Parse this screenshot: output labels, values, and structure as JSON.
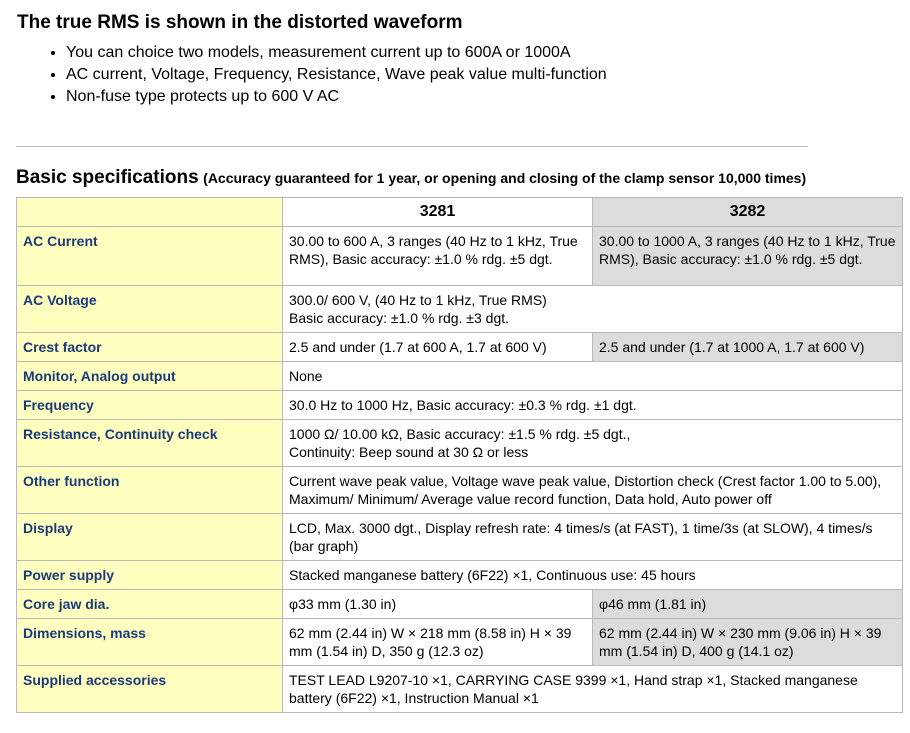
{
  "header": {
    "title": "The true RMS is shown in the distorted waveform",
    "bullets": [
      "You can choice two models, measurement current up to 600A or 1000A",
      "AC current, Voltage, Frequency, Resistance, Wave peak value multi-function",
      "Non-fuse type protects up to 600 V AC"
    ]
  },
  "specs": {
    "title": "Basic specifications",
    "note": "(Accuracy guaranteed for 1 year, or opening and closing of the clamp sensor 10,000 times)",
    "models": [
      "3281",
      "3282"
    ],
    "rows": [
      {
        "label": "AC Current",
        "a": "30.00 to 600 A, 3 ranges (40 Hz to 1 kHz, True RMS), Basic accuracy: ±1.0 % rdg. ±5 dgt.",
        "b": "30.00 to 1000 A, 3 ranges (40 Hz to 1 kHz, True RMS), Basic accuracy: ±1.0 % rdg. ±5 dgt."
      },
      {
        "label": "AC Voltage",
        "shared": "300.0/ 600 V, (40 Hz to 1 kHz, True RMS)\nBasic accuracy: ±1.0 % rdg. ±3 dgt."
      },
      {
        "label": "Crest factor",
        "a": "2.5 and under (1.7 at 600 A, 1.7 at 600 V)",
        "b": "2.5 and under (1.7 at 1000 A, 1.7 at 600 V)"
      },
      {
        "label": "Monitor, Analog output",
        "shared": "None"
      },
      {
        "label": "Frequency",
        "shared": "30.0 Hz to 1000 Hz, Basic accuracy: ±0.3 % rdg. ±1 dgt."
      },
      {
        "label": "Resistance, Continuity check",
        "shared": "1000 Ω/ 10.00 kΩ, Basic accuracy: ±1.5 % rdg. ±5 dgt.,\nContinuity: Beep sound at 30 Ω or less"
      },
      {
        "label": "Other function",
        "shared": "Current wave peak value, Voltage wave peak value, Distortion check (Crest factor 1.00 to 5.00), Maximum/ Minimum/ Average value record function, Data hold, Auto power off"
      },
      {
        "label": "Display",
        "shared": "LCD, Max. 3000 dgt., Display refresh rate: 4 times/s (at FAST), 1 time/3s (at SLOW), 4 times/s (bar graph)"
      },
      {
        "label": "Power supply",
        "shared": "Stacked manganese battery (6F22) ×1, Continuous use: 45 hours"
      },
      {
        "label": "Core jaw dia.",
        "a": "φ33 mm (1.30 in)",
        "b": "φ46 mm (1.81 in)"
      },
      {
        "label": "Dimensions, mass",
        "a": "62 mm (2.44 in) W × 218 mm (8.58 in) H × 39 mm (1.54 in) D, 350 g (12.3 oz)",
        "b": "62 mm (2.44 in) W × 230 mm (9.06 in) H × 39 mm (1.54 in) D, 400 g (14.1 oz)"
      },
      {
        "label": "Supplied accessories",
        "shared": "TEST LEAD L9207-10 ×1, CARRYING CASE 9399 ×1, Hand strap ×1, Stacked manganese battery (6F22) ×1, Instruction Manual ×1"
      }
    ]
  },
  "colors": {
    "label_bg": "#ffffc0",
    "label_text": "#1a3a7a",
    "model_b_bg": "#dcdcdc",
    "border": "#b9b9b9"
  }
}
